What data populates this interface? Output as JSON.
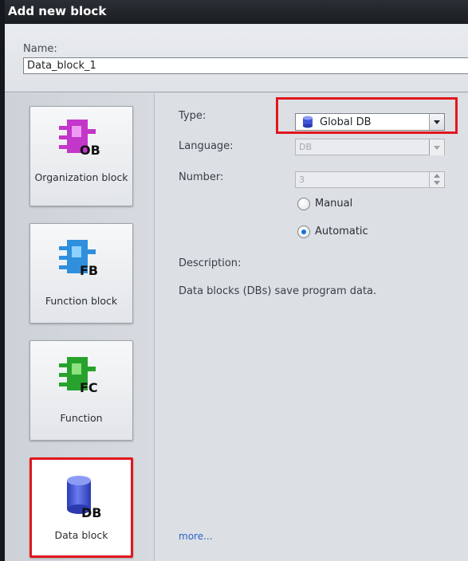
{
  "window": {
    "title": "Add new block"
  },
  "name_field": {
    "label": "Name:",
    "value": "Data_block_1"
  },
  "block_types": [
    {
      "id": "ob",
      "badge": "OB",
      "label": "Organization block",
      "color": "#c236c9",
      "selected": false
    },
    {
      "id": "fb",
      "badge": "FB",
      "label": "Function block",
      "color": "#2f8fdc",
      "selected": false
    },
    {
      "id": "fc",
      "badge": "FC",
      "label": "Function",
      "color": "#27a32d",
      "selected": false
    },
    {
      "id": "db",
      "badge": "DB",
      "label": "Data block",
      "color": "#3f53d6",
      "selected": true
    }
  ],
  "properties": {
    "type_label": "Type:",
    "type_value": "Global DB",
    "language_label": "Language:",
    "language_value": "DB",
    "number_label": "Number:",
    "number_value": "3",
    "radio_manual": "Manual",
    "radio_automatic": "Automatic",
    "radio_selected": "Automatic",
    "description_label": "Description:",
    "description_text": "Data blocks (DBs) save program data.",
    "more_link": "more..."
  },
  "colors": {
    "highlight": "#e0171d",
    "title_bar": "#1f2226",
    "radio_dot": "#1673d6"
  }
}
